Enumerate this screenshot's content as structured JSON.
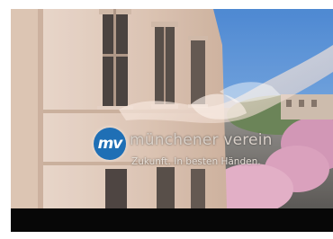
{
  "logo": {
    "badge_text": "mv",
    "name": "münchener verein",
    "tagline": "Zukunft. In besten Händen."
  },
  "colors": {
    "badge": "#1f6fb5",
    "sky": "#4d86c8",
    "facade": "#e6d0c2",
    "letterbox": "#070707"
  }
}
